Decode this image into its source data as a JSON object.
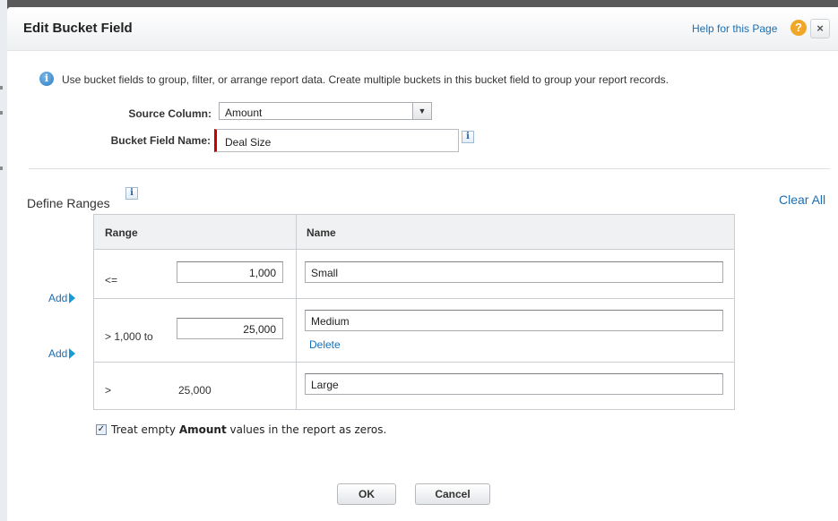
{
  "dialog": {
    "title": "Edit Bucket Field",
    "help_label": "Help for this Page",
    "help_icon": "?",
    "close_label": "×"
  },
  "intro": {
    "icon": "i",
    "text": "Use bucket fields to group, filter, or arrange report data. Create multiple buckets in this bucket field to group your report records."
  },
  "form": {
    "source_column_label": "Source Column:",
    "source_column_value": "Amount",
    "bucket_field_name_label": "Bucket Field Name:",
    "bucket_field_name_value": "Deal Size",
    "info_glyph": "i"
  },
  "ranges": {
    "title": "Define Ranges",
    "clear_all": "Clear All",
    "col_range": "Range",
    "col_name": "Name",
    "add_label": "Add",
    "delete_label": "Delete",
    "rows": [
      {
        "operator": "<=",
        "value": "1,000",
        "name": "Small"
      },
      {
        "operator": "> 1,000 to",
        "value": "25,000",
        "name": "Medium"
      },
      {
        "operator": ">",
        "value": "25,000",
        "name": "Large"
      }
    ]
  },
  "options": {
    "check_mark": "✓",
    "treat_empty_prefix": "Treat empty",
    "treat_empty_field": "Amount",
    "treat_empty_suffix": "values in the report as zeros."
  },
  "buttons": {
    "ok": "OK",
    "cancel": "Cancel"
  },
  "colors": {
    "link": "#1a6fb5",
    "required_marker": "#cc0000",
    "help_icon": "#f0a626"
  }
}
